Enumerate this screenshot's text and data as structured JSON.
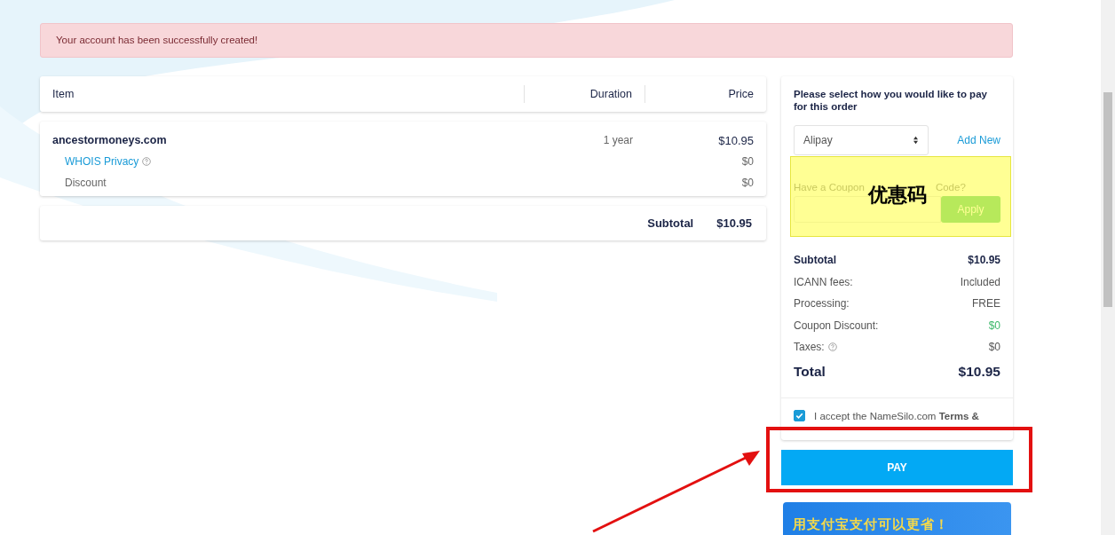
{
  "alert": {
    "text": "Your account has been successfully created!"
  },
  "order_table": {
    "columns": [
      "Item",
      "Duration",
      "Price"
    ],
    "rows": [
      {
        "kind": "domain",
        "item": "ancestormoneys.com",
        "duration": "1 year",
        "price": "$10.95"
      },
      {
        "kind": "addon",
        "item": "WHOIS Privacy",
        "help": true,
        "price": "$0"
      },
      {
        "kind": "discount",
        "item": "Discount",
        "price": "$0"
      }
    ],
    "subtotal": {
      "label": "Subtotal",
      "value": "$10.95"
    }
  },
  "payment": {
    "title": "Please select how you would like to pay for this order",
    "method": "Alipay",
    "add_new": "Add New",
    "coupon_label_parts": [
      "Have a Coupon",
      "Code?"
    ],
    "apply_button": "Apply",
    "summary": [
      {
        "kind": "strong",
        "label": "Subtotal",
        "value": "$10.95"
      },
      {
        "kind": "plain",
        "label": "ICANN fees:",
        "value": "Included"
      },
      {
        "kind": "plain",
        "label": "Processing:",
        "value": "FREE"
      },
      {
        "kind": "discount",
        "label": "Coupon Discount:",
        "value": "$0"
      },
      {
        "kind": "help",
        "label": "Taxes:",
        "value": "$0"
      },
      {
        "kind": "total",
        "label": "Total",
        "value": "$10.95"
      }
    ],
    "terms": {
      "checked": true,
      "text": "I accept the NameSilo.com **Terms &**"
    },
    "pay_button": "PAY",
    "promo_banner": "用支付宝支付可以更省！"
  },
  "annotations": {
    "coupon_callout": "优惠码"
  }
}
